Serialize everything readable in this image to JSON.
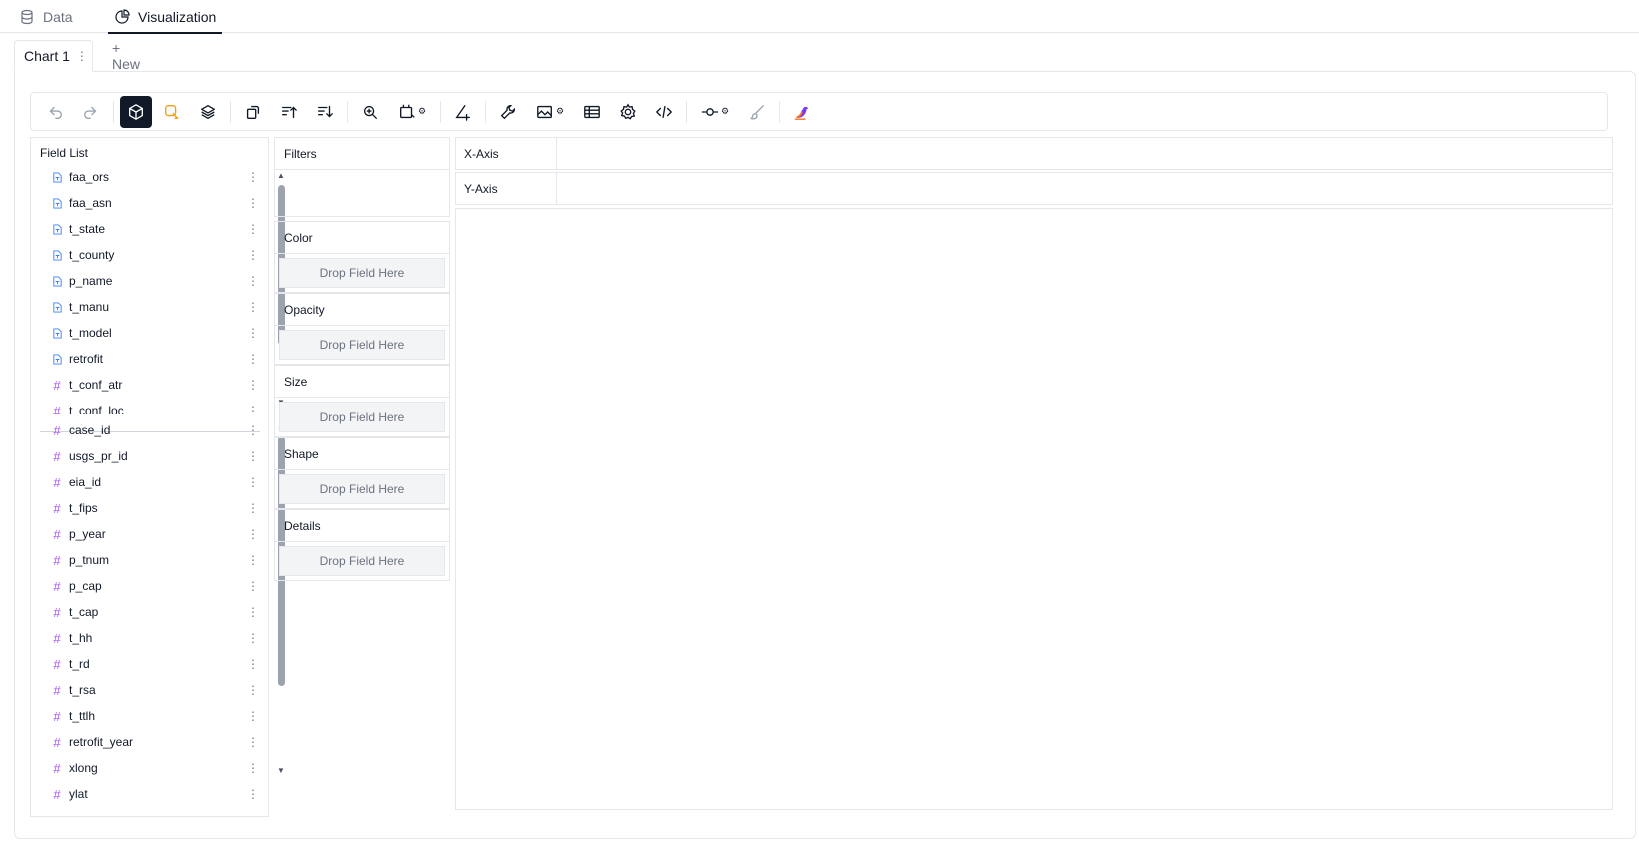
{
  "top_tabs": [
    {
      "label": "Data",
      "icon": "database-icon"
    },
    {
      "label": "Visualization",
      "icon": "chart-pie-icon",
      "active": true
    }
  ],
  "chart_tabs": {
    "current": "Chart 1",
    "menu": "⋮",
    "new_label": "+ New"
  },
  "toolbar": {
    "buttons": [
      "undo",
      "redo",
      "cube",
      "brush-lasso",
      "layers",
      "transpose",
      "sort-asc",
      "sort-desc",
      "zoom",
      "size-mode",
      "axis-tools",
      "wrench",
      "image-export",
      "table",
      "settings",
      "code",
      "measure-slider",
      "paint-brush",
      "logo"
    ]
  },
  "field_list": {
    "title": "Field List",
    "dimensions": [
      {
        "name": "faa_ors",
        "type": "dimension"
      },
      {
        "name": "faa_asn",
        "type": "dimension"
      },
      {
        "name": "t_state",
        "type": "dimension"
      },
      {
        "name": "t_county",
        "type": "dimension"
      },
      {
        "name": "p_name",
        "type": "dimension"
      },
      {
        "name": "t_manu",
        "type": "dimension"
      },
      {
        "name": "t_model",
        "type": "dimension"
      },
      {
        "name": "retrofit",
        "type": "dimension"
      },
      {
        "name": "t_conf_atr",
        "type": "measure"
      },
      {
        "name": "t_conf_loc",
        "type": "measure"
      }
    ],
    "measures": [
      {
        "name": "case_id"
      },
      {
        "name": "usgs_pr_id"
      },
      {
        "name": "eia_id"
      },
      {
        "name": "t_fips"
      },
      {
        "name": "p_year"
      },
      {
        "name": "p_tnum"
      },
      {
        "name": "p_cap"
      },
      {
        "name": "t_cap"
      },
      {
        "name": "t_hh"
      },
      {
        "name": "t_rd"
      },
      {
        "name": "t_rsa"
      },
      {
        "name": "t_ttlh"
      },
      {
        "name": "retrofit_year"
      },
      {
        "name": "xlong"
      },
      {
        "name": "ylat"
      }
    ]
  },
  "encodings": {
    "filters": "Filters",
    "drop_placeholder": "Drop Field Here",
    "channels": [
      "Color",
      "Opacity",
      "Size",
      "Shape",
      "Details"
    ]
  },
  "axes": {
    "x": "X-Axis",
    "y": "Y-Axis"
  },
  "colors": {
    "accent": "#111827",
    "dimension_icon": "#3b82f6",
    "measure_icon": "#a855f7",
    "lasso_orange": "#f59e0b"
  }
}
